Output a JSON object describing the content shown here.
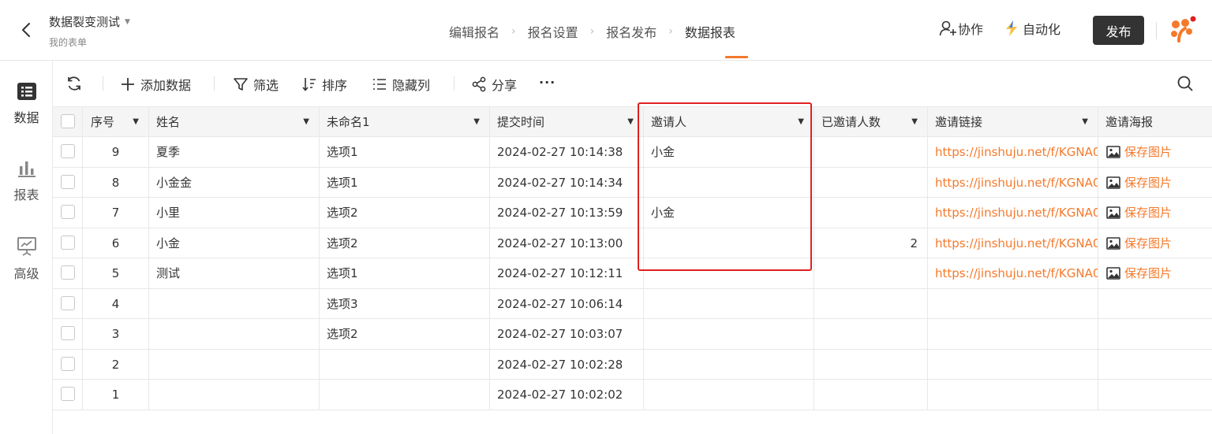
{
  "header": {
    "form_title": "数据裂变测试",
    "form_subtitle": "我的表单",
    "steps": [
      "编辑报名",
      "报名设置",
      "报名发布",
      "数据报表"
    ],
    "active_step": 3,
    "collab_label": "协作",
    "automation_label": "自动化",
    "publish_label": "发布"
  },
  "sidebar": {
    "items": [
      {
        "label": "数据",
        "icon": "list-icon"
      },
      {
        "label": "报表",
        "icon": "bar-chart-icon"
      },
      {
        "label": "高级",
        "icon": "presentation-icon"
      }
    ]
  },
  "toolbar": {
    "add_label": "添加数据",
    "filter_label": "筛选",
    "sort_label": "排序",
    "hide_label": "隐藏列",
    "share_label": "分享",
    "more_label": "···"
  },
  "table": {
    "columns": [
      "序号",
      "姓名",
      "未命名1",
      "提交时间",
      "邀请人",
      "已邀请人数",
      "邀请链接",
      "邀请海报"
    ],
    "rows": [
      {
        "seq": "9",
        "name": "夏季",
        "opt": "选项1",
        "time": "2024-02-27 10:14:38",
        "inviter": "小金",
        "count": "",
        "link": "https://jinshuju.net/f/KGNA0",
        "poster": "保存图片"
      },
      {
        "seq": "8",
        "name": "小金金",
        "opt": "选项1",
        "time": "2024-02-27 10:14:34",
        "inviter": "",
        "count": "",
        "link": "https://jinshuju.net/f/KGNA0",
        "poster": "保存图片"
      },
      {
        "seq": "7",
        "name": "小里",
        "opt": "选项2",
        "time": "2024-02-27 10:13:59",
        "inviter": "小金",
        "count": "",
        "link": "https://jinshuju.net/f/KGNA0",
        "poster": "保存图片"
      },
      {
        "seq": "6",
        "name": "小金",
        "opt": "选项2",
        "time": "2024-02-27 10:13:00",
        "inviter": "",
        "count": "2",
        "link": "https://jinshuju.net/f/KGNA0",
        "poster": "保存图片"
      },
      {
        "seq": "5",
        "name": "测试",
        "opt": "选项1",
        "time": "2024-02-27 10:12:11",
        "inviter": "",
        "count": "",
        "link": "https://jinshuju.net/f/KGNA0",
        "poster": "保存图片"
      },
      {
        "seq": "4",
        "name": "",
        "opt": "选项3",
        "time": "2024-02-27 10:06:14",
        "inviter": "",
        "count": "",
        "link": "",
        "poster": ""
      },
      {
        "seq": "3",
        "name": "",
        "opt": "选项2",
        "time": "2024-02-27 10:03:07",
        "inviter": "",
        "count": "",
        "link": "",
        "poster": ""
      },
      {
        "seq": "2",
        "name": "",
        "opt": "",
        "time": "2024-02-27 10:02:28",
        "inviter": "",
        "count": "",
        "link": "",
        "poster": ""
      },
      {
        "seq": "1",
        "name": "",
        "opt": "",
        "time": "2024-02-27 10:02:02",
        "inviter": "",
        "count": "",
        "link": "",
        "poster": ""
      }
    ]
  },
  "colors": {
    "accent": "#f5792a",
    "highlight": "#e02020",
    "publish_bg": "#333333"
  }
}
